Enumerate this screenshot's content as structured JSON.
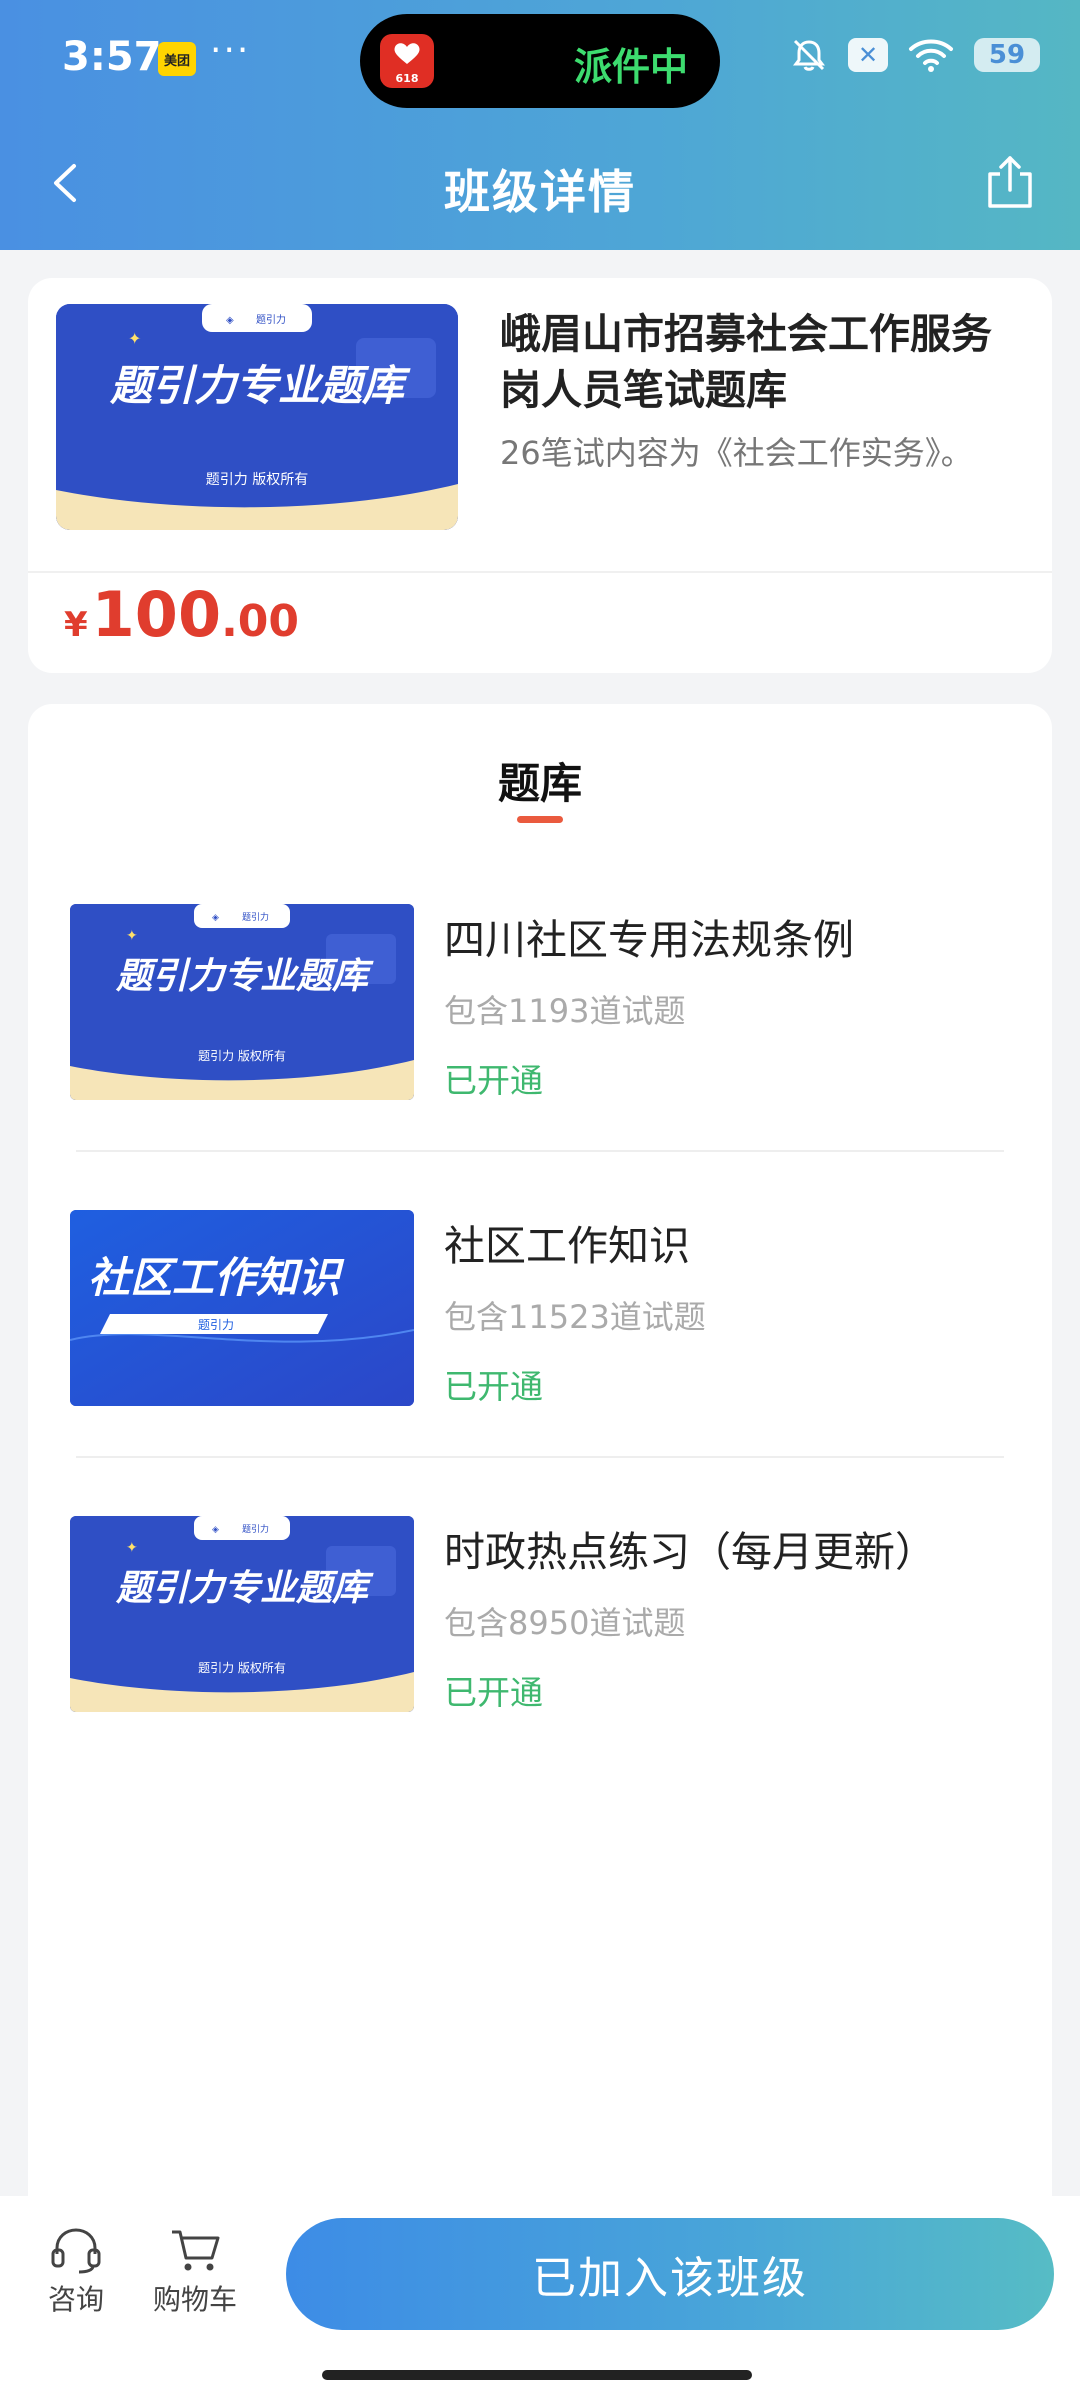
{
  "status_bar": {
    "time": "3:57",
    "meituan": "美团",
    "more": "···",
    "live_activity": "派件中",
    "pdd_badge": "618",
    "battery": "59",
    "x_icon": "✕"
  },
  "nav": {
    "title": "班级详情"
  },
  "class_card": {
    "thumb_title": "题引力专业题库",
    "thumb_brand": "题引力",
    "thumb_footer": "题引力 版权所有",
    "title": "峨眉山市招募社会工作服务岗人员笔试题库",
    "desc": "26笔试内容为《社会工作实务》。",
    "price_symbol": "¥",
    "price_int": "100",
    "price_dec": ".00"
  },
  "section": {
    "title": "题库"
  },
  "items": [
    {
      "thumb_title": "题引力专业题库",
      "thumb_brand": "题引力",
      "thumb_footer": "题引力 版权所有",
      "title": "四川社区专用法规条例",
      "count": "包含1193道试题",
      "status": "已开通"
    },
    {
      "thumb_title": "社区工作知识",
      "thumb_brand": "题引力",
      "title": "社区工作知识",
      "count": "包含11523道试题",
      "status": "已开通"
    },
    {
      "thumb_title": "题引力专业题库",
      "thumb_brand": "题引力",
      "thumb_footer": "题引力 版权所有",
      "title": "时政热点练习（每月更新）",
      "count": "包含8950道试题",
      "status": "已开通"
    }
  ],
  "bottom": {
    "consult": "咨询",
    "cart": "购物车",
    "join": "已加入该班级"
  },
  "colors": {
    "header_start": "#4a90e2",
    "header_end": "#55b7c4",
    "price": "#e03d2e",
    "status_open": "#3fb86f",
    "accent_underline": "#ea5a3e",
    "thumb_blue": "#2f4fc5"
  },
  "icons": {
    "back": "chevron-left-icon",
    "share": "share-icon",
    "consult": "headset-icon",
    "cart": "cart-icon",
    "mute": "bell-off-icon",
    "wifi": "wifi-icon",
    "battery": "battery-icon"
  }
}
